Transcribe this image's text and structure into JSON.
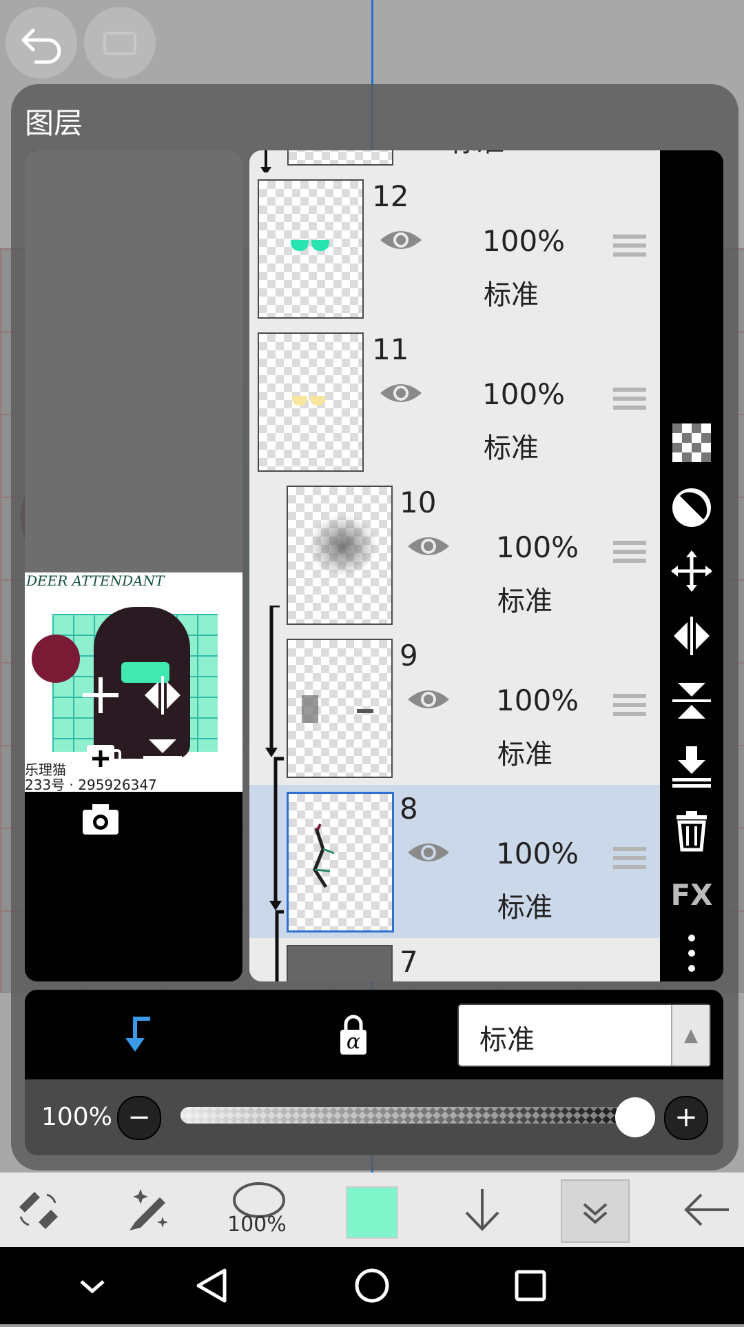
{
  "panel": {
    "title": "图层"
  },
  "preview": {
    "art_title": "DEER ATTENDANT",
    "signature_line1": "乐理猫",
    "signature_line2": "233号 · 295926347"
  },
  "preview_tools": [
    {
      "icon": "add-layer-icon"
    },
    {
      "icon": "flip-horizontal-icon"
    },
    {
      "icon": "add-folder-icon"
    },
    {
      "icon": "flip-vertical-icon"
    },
    {
      "icon": "camera-icon"
    }
  ],
  "layers": [
    {
      "num": "12",
      "opacity": "100%",
      "blend": "标准",
      "visible": true,
      "selected": false,
      "clipped": false
    },
    {
      "num": "11",
      "opacity": "100%",
      "blend": "标准",
      "visible": true,
      "selected": false,
      "clipped": false
    },
    {
      "num": "10",
      "opacity": "100%",
      "blend": "标准",
      "visible": true,
      "selected": false,
      "clipped": true
    },
    {
      "num": "9",
      "opacity": "100%",
      "blend": "标准",
      "visible": true,
      "selected": false,
      "clipped": true
    },
    {
      "num": "8",
      "opacity": "100%",
      "blend": "标准",
      "visible": true,
      "selected": true,
      "clipped": true
    },
    {
      "num": "7"
    }
  ],
  "top_partial_layer": {
    "blend": "标准"
  },
  "right_toolbar": [
    {
      "icon": "transparency-icon"
    },
    {
      "icon": "invert-icon"
    },
    {
      "icon": "move-icon"
    },
    {
      "icon": "flip-horizontal-icon"
    },
    {
      "icon": "flip-vertical-icon"
    },
    {
      "icon": "merge-down-icon"
    },
    {
      "icon": "delete-icon"
    },
    {
      "label": "FX"
    },
    {
      "icon": "more-vertical-icon"
    }
  ],
  "mode_bar": {
    "blend_mode": "标准",
    "lock_label": "α"
  },
  "opacity_control": {
    "label": "100%",
    "value": 1.0
  },
  "app_toolbar": {
    "brush_size": "100%",
    "color": "#7ff5cc"
  }
}
